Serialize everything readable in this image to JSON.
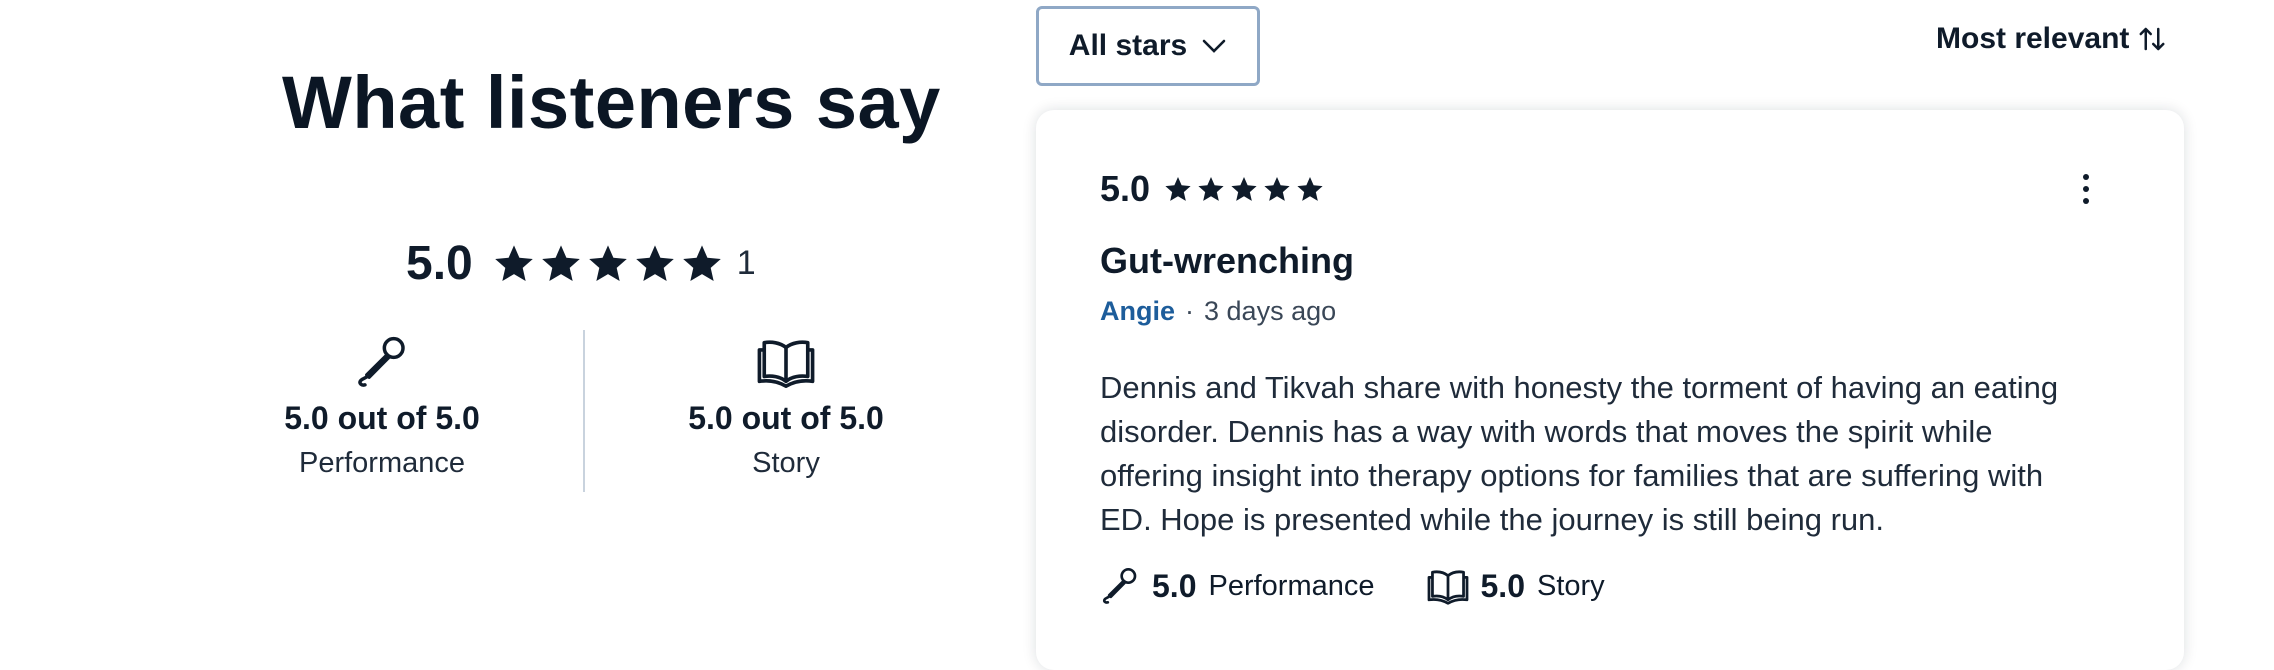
{
  "left_panel": {
    "heading": "What listeners say",
    "overall": {
      "score": "5.0",
      "stars": 5,
      "count": "1"
    },
    "categories": [
      {
        "icon": "microphone-icon",
        "score_text": "5.0 out of 5.0",
        "label": "Performance"
      },
      {
        "icon": "open-book-icon",
        "score_text": "5.0 out of 5.0",
        "label": "Story"
      }
    ]
  },
  "filter": {
    "label": "All stars",
    "icon": "chevron-down-icon"
  },
  "sort": {
    "label": "Most relevant",
    "icon": "sort-arrows-icon"
  },
  "review": {
    "score": "5.0",
    "stars": 5,
    "title": "Gut-wrenching",
    "author": "Angie",
    "separator": "·",
    "date": "3 days ago",
    "body": "Dennis and Tikvah share with honesty the torment of having an eating disorder. Dennis has a way with words that moves the spirit while offering insight into therapy options for families that are suffering with ED. Hope is presented while the journey is still being run.",
    "categories": [
      {
        "icon": "microphone-icon",
        "score": "5.0",
        "label": "Performance"
      },
      {
        "icon": "open-book-icon",
        "score": "5.0",
        "label": "Story"
      }
    ],
    "menu_icon": "more-vertical-icon"
  },
  "colors": {
    "text": "#0f1b2a",
    "author_link": "#1d5d9b",
    "filter_border": "#8fa8c6",
    "divider": "#c9d3de"
  }
}
